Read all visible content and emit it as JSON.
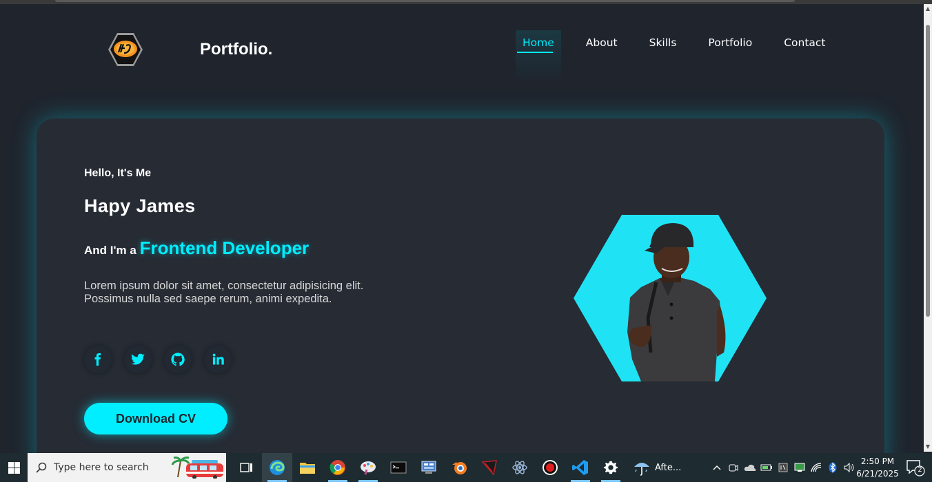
{
  "site": {
    "brand": "Portfolio.",
    "nav": [
      "Home",
      "About",
      "Skills",
      "Portfolio",
      "Contact"
    ],
    "active_nav": "Home"
  },
  "hero": {
    "greeting": "Hello, It's Me",
    "name": "Hapy James",
    "role_prefix": "And I'm a ",
    "role": "Frontend Developer",
    "description": "Lorem ipsum dolor sit amet, consectetur adipisicing elit. Possimus nulla sed saepe rerum, animi expedita.",
    "socials": [
      "facebook-icon",
      "twitter-icon",
      "github-icon",
      "linkedin-icon"
    ],
    "cta_label": "Download CV"
  },
  "taskbar": {
    "search_placeholder": "Type here to search",
    "weather": "Afte...",
    "time": "2:50 PM",
    "date": "6/21/2025",
    "notification_count": "2"
  },
  "colors": {
    "accent": "#00eeff",
    "background": "#1f242d",
    "panel": "#262b34"
  }
}
